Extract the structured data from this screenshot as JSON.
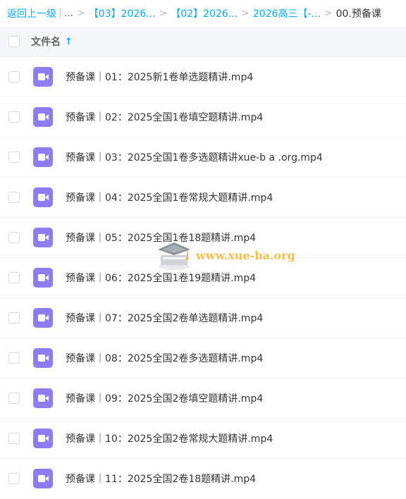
{
  "breadcrumb": {
    "back_label": "返回上一级",
    "ellipsis": "...",
    "links": [
      "【03】2026...",
      "【02】2026...",
      "2026高三【-..."
    ],
    "current": "00.预备课"
  },
  "header": {
    "column_name": "文件名",
    "sort_arrow": "↑"
  },
  "files": [
    {
      "name": "预备课｜01：2025新1卷单选题精讲.mp4"
    },
    {
      "name": "预备课｜02：2025全国1卷填空题精讲.mp4"
    },
    {
      "name": "预备课｜03：2025全国1卷多选题精讲xue-b a .org.mp4"
    },
    {
      "name": "预备课｜04：2025全国1卷常规大题精讲.mp4"
    },
    {
      "name": "预备课｜05：2025全国1卷18题精讲.mp4"
    },
    {
      "name": "预备课｜06：2025全国1卷19题精讲.mp4"
    },
    {
      "name": "预备课｜07：2025全国2卷单选题精讲.mp4"
    },
    {
      "name": "预备课｜08：2025全国2卷多选题精讲.mp4"
    },
    {
      "name": "预备课｜09：2025全国2卷填空题精讲.mp4"
    },
    {
      "name": "预备课｜10：2025全国2卷常规大题精讲.mp4"
    },
    {
      "name": "预备课｜11：2025全国2卷18题精讲.mp4"
    }
  ],
  "watermark": {
    "text": "www.xue-ba.org"
  },
  "colors": {
    "accent": "#06a7ff",
    "video_icon": "#8e7cf2",
    "header_bg": "#f5f6fa"
  },
  "icons": {
    "file": "video-file-icon",
    "sort": "sort-ascending-icon"
  }
}
